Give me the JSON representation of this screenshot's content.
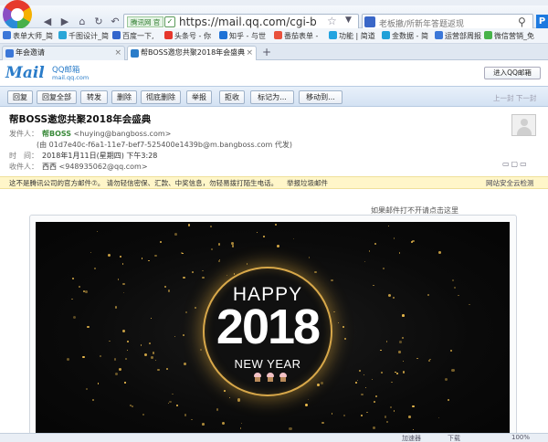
{
  "browser": {
    "url": "https://mail.qq.com/cgi-bin/frai",
    "site_badge": "腾讯网 官",
    "search_placeholder": "老板撤/所新年答题返现",
    "profile_letter": "P",
    "bookmarks": [
      {
        "label": "表单大师_简",
        "color": "#3b77d8"
      },
      {
        "label": "千图设计_简",
        "color": "#2aa6d8"
      },
      {
        "label": "百度一下,",
        "color": "#3366cc"
      },
      {
        "label": "头条号 - 你",
        "color": "#e6372c"
      },
      {
        "label": "知乎 - 与世",
        "color": "#1f72d6"
      },
      {
        "label": "番茄表单 -",
        "color": "#e9513c"
      },
      {
        "label": "功能 | 简道",
        "color": "#22a3e0"
      },
      {
        "label": "金数据 - 简",
        "color": "#1fa0d8"
      },
      {
        "label": "运营部周报",
        "color": "#3b77d8"
      },
      {
        "label": "微信营销_免",
        "color": "#47b34a"
      }
    ],
    "tabs": [
      {
        "label": "年会邀请",
        "active": false
      },
      {
        "label": "帮BOSS邀您共聚2018年会盛典",
        "active": true
      }
    ],
    "newtab_label": "+"
  },
  "mail": {
    "logo": "Mail",
    "logo_cn": "QQ邮箱",
    "logo_domain": "mail.qq.com",
    "enter_label": "进入QQ邮箱",
    "toolbar": [
      "回复",
      "回复全部",
      "转发",
      "删除",
      "彻底删除",
      "举报",
      "拒收",
      "标记为...",
      "移动到..."
    ],
    "prevnext": "上一封  下一封",
    "subject": "帮BOSS邀您共聚2018年会盛典",
    "star": "☆",
    "from_label": "发件人：",
    "from_name": "帮BOSS",
    "from_email": "<huying@bangboss.com>",
    "proxy_line": "(由 01d7e40c-f6a1-11e7-bef7-525400e1439b@m.bangboss.com 代发)",
    "time_label": "时　间：",
    "time_value": "2018年1月11日(星期四) 下午3:28",
    "to_label": "收件人：",
    "to_name": "西西",
    "to_email": "<948935062@qq.com>",
    "warning": "这不是腾讯公司的官方邮件⑦。 请勿轻信密保、汇款、中奖信息，勿轻易拨打陌生电话。",
    "report_link": "举报垃圾邮件",
    "safe_check": "网站安全云检测",
    "cant_see": "如果邮件打不开请点击这里",
    "banner_happy": "HAPPY",
    "banner_year": "2018",
    "banner_newyear": "NEW YEAR"
  },
  "statusbar": {
    "accel": "加速器",
    "download": "下载",
    "zoom": "100%"
  }
}
